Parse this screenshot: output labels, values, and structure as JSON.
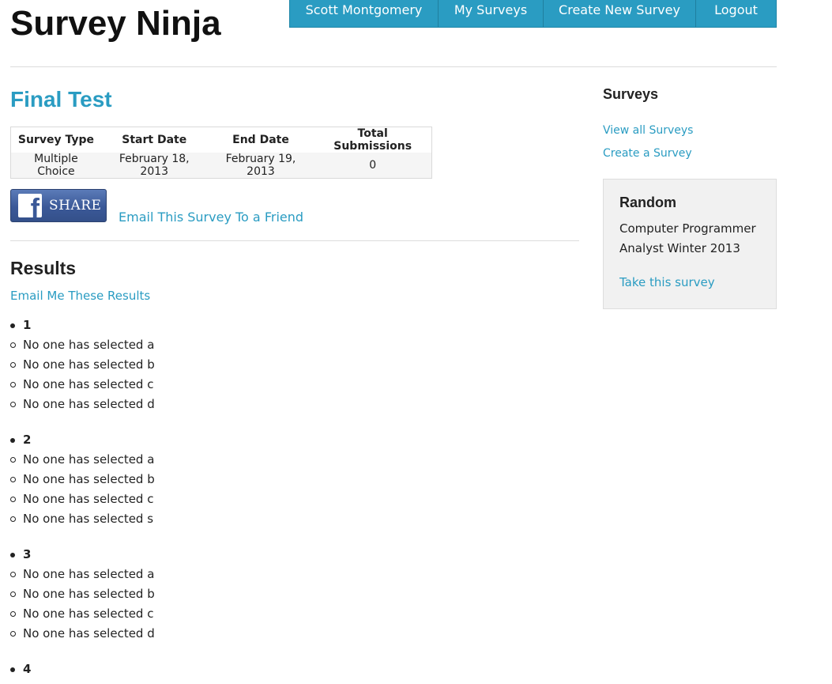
{
  "header": {
    "brand": "Survey Ninja",
    "nav": [
      "Scott Montgomery",
      "My Surveys",
      "Create New Survey",
      "Logout"
    ]
  },
  "survey": {
    "title": "Final Test",
    "table": {
      "headers": [
        "Survey Type",
        "Start Date",
        "End Date",
        "Total Submissions"
      ],
      "row": [
        "Multiple Choice",
        "February 18, 2013",
        "February 19, 2013",
        "0"
      ]
    },
    "share_label": "SHARE",
    "fb_logo_letter": "f",
    "email_friend": "Email This Survey To a Friend"
  },
  "results": {
    "title": "Results",
    "email_me": "Email Me These Results",
    "questions": [
      {
        "number": "1",
        "answers": [
          "No one has selected a",
          "No one has selected b",
          "No one has selected c",
          "No one has selected d"
        ]
      },
      {
        "number": "2",
        "answers": [
          "No one has selected a",
          "No one has selected b",
          "No one has selected c",
          "No one has selected s"
        ]
      },
      {
        "number": "3",
        "answers": [
          "No one has selected a",
          "No one has selected b",
          "No one has selected c",
          "No one has selected d"
        ]
      },
      {
        "number": "4",
        "answers": []
      }
    ]
  },
  "sidebar": {
    "title": "Surveys",
    "links": [
      "View all Surveys",
      "Create a Survey"
    ],
    "random": {
      "title": "Random",
      "survey_name": "Computer Programmer Analyst Winter 2013",
      "take_label": "Take this survey"
    }
  }
}
